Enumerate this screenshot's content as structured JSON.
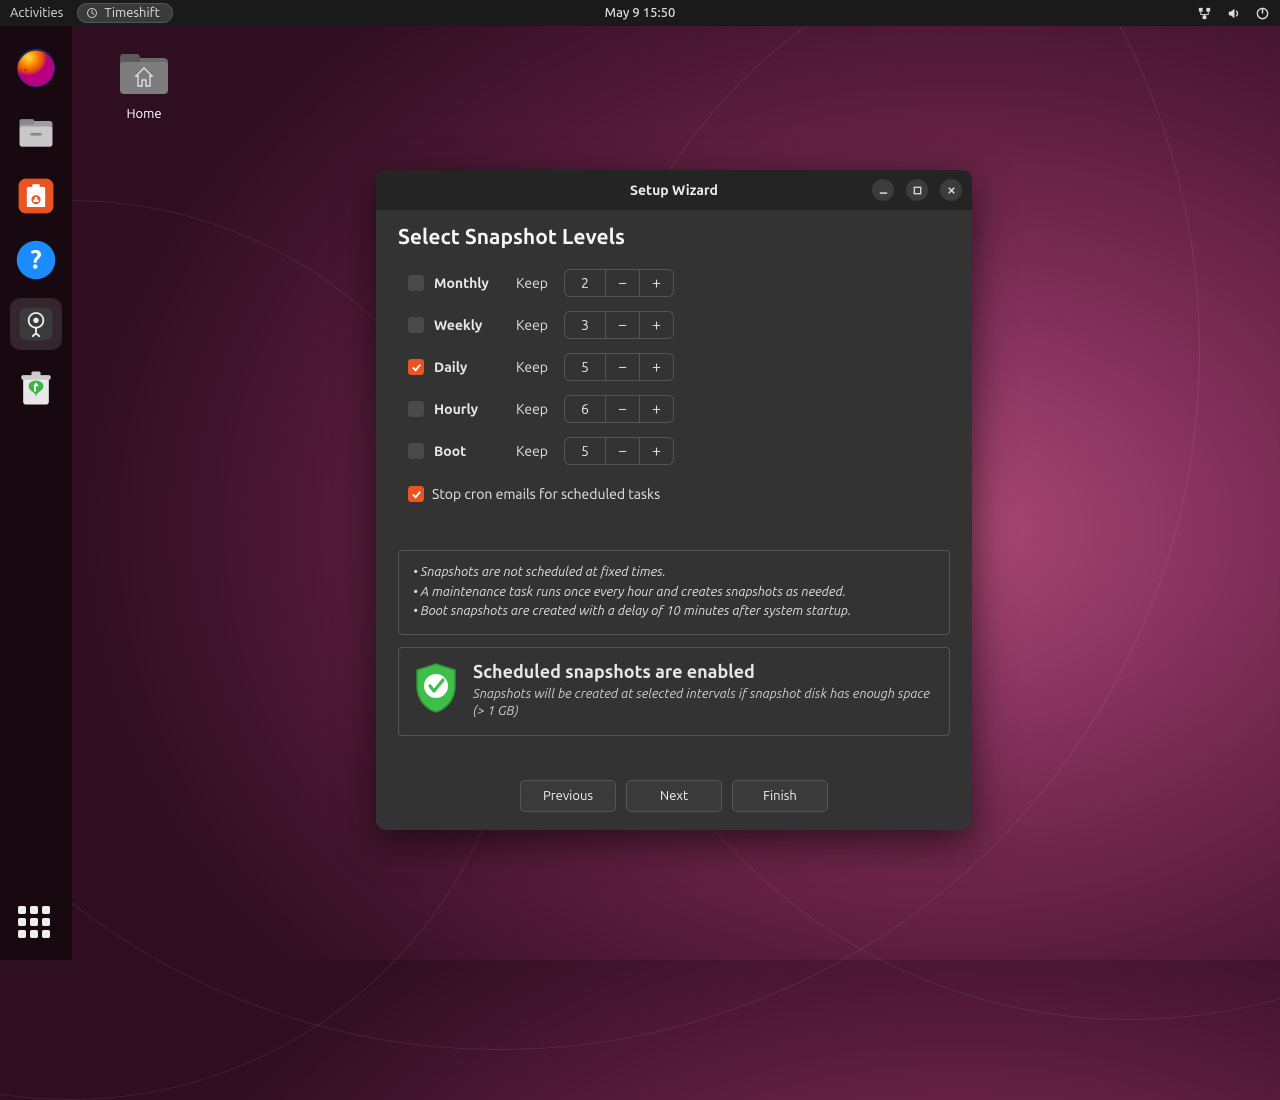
{
  "topbar": {
    "activities": "Activities",
    "app_name": "Timeshift",
    "clock": "May 9  15:50"
  },
  "desktop": {
    "home_label": "Home"
  },
  "window": {
    "title": "Setup Wizard",
    "heading": "Select Snapshot Levels",
    "keep_label": "Keep",
    "levels": [
      {
        "name": "Monthly",
        "checked": false,
        "value": "2"
      },
      {
        "name": "Weekly",
        "checked": false,
        "value": "3"
      },
      {
        "name": "Daily",
        "checked": true,
        "value": "5"
      },
      {
        "name": "Hourly",
        "checked": false,
        "value": "6"
      },
      {
        "name": "Boot",
        "checked": false,
        "value": "5"
      }
    ],
    "cron_checkbox_label": "Stop cron emails for scheduled tasks",
    "info_lines": [
      "• Snapshots are not scheduled at fixed times.",
      "• A maintenance task runs once every hour and creates snapshots as needed.",
      "• Boot snapshots are created with a delay of 10 minutes after system startup."
    ],
    "status_title": "Scheduled snapshots are enabled",
    "status_desc": "Snapshots will be created at selected intervals if snapshot disk has enough space (> 1 GB)",
    "buttons": {
      "previous": "Previous",
      "next": "Next",
      "finish": "Finish"
    }
  }
}
